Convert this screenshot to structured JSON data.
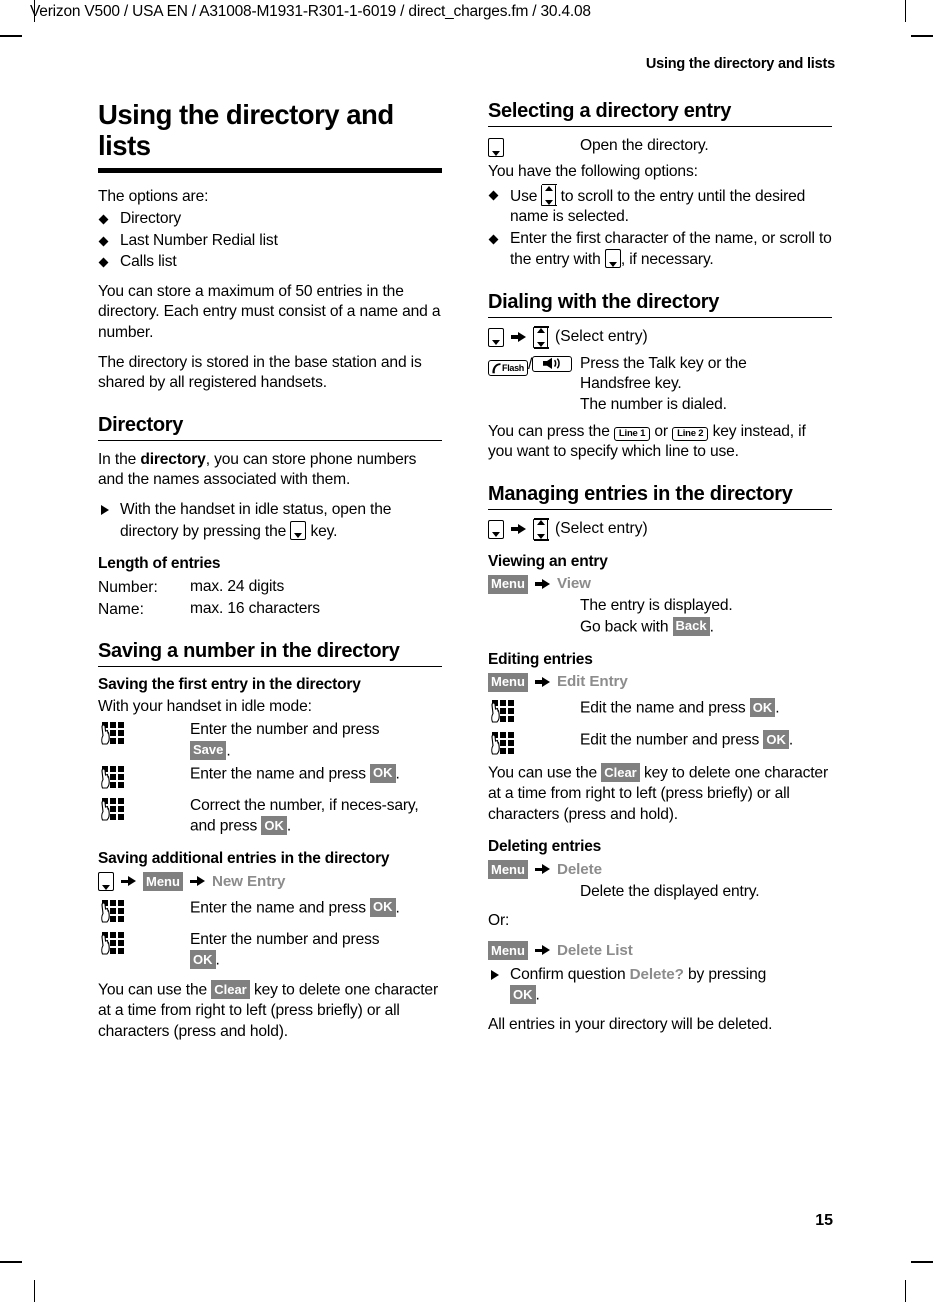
{
  "page": {
    "filemark": "Verizon V500 / USA EN / A31008-M1931-R301-1-6019 / direct_charges.fm / 30.4.08",
    "running_head": "Using the directory and lists",
    "page_number": "15"
  },
  "icons": {
    "directory_key": "directory-down-key-icon",
    "scroll_key": "up-down-scroll-key-icon",
    "keypad": "keypad-entry-icon",
    "talk_key": "talk-flash-key-icon",
    "handsfree_key": "handsfree-speaker-key-icon",
    "arrow": "right-arrow-icon"
  },
  "colors": {
    "softkey_bg": "#808080",
    "softkey_fg": "#ffffff",
    "menu_item_fg": "#8c8c8c",
    "rule": "#000000"
  },
  "left_column": {
    "chapter_title": "Using the directory and lists",
    "intro_lead": "The options are:",
    "options": [
      "Directory",
      "Last Number Redial list",
      "Calls list"
    ],
    "para_capacity": "You can store a maximum of 50 entries in the directory. Each entry must consist of a name and a number.",
    "para_shared": "The directory is stored in the base station and is shared by all registered handsets.",
    "directory": {
      "heading": "Directory",
      "intro_a": "In the ",
      "intro_bold": "directory",
      "intro_b": ", you can store phone numbers and the names associated with them.",
      "bullet_a": "With the handset in idle status, open the directory by pressing the",
      "bullet_b": "key.",
      "length_heading": "Length of entries",
      "length_rows": [
        {
          "label": "Number:",
          "value": "max. 24 digits"
        },
        {
          "label": "Name:",
          "value": "max. 16 characters"
        }
      ]
    },
    "saving": {
      "heading": "Saving a number in the directory",
      "first_entry": {
        "heading": "Saving the first entry in the directory",
        "lead": "With your handset in idle mode:",
        "step1_a": "Enter the number and press",
        "step1_key": "Save",
        "step1_b": ".",
        "step2_a": "Enter the name and press",
        "step2_key": "OK",
        "step2_b": ".",
        "step3_a": "Correct the number, if neces-sary, and press",
        "step3_key": "OK",
        "step3_b": "."
      },
      "additional": {
        "heading": "Saving additional entries in the directory",
        "path_menu": "Menu",
        "path_item": "New Entry",
        "step1_a": "Enter the name and press",
        "step1_key": "OK",
        "step1_b": ".",
        "step2_a": "Enter the number and press",
        "step2_key": "OK",
        "step2_b": "."
      },
      "clear_note_a": "You can use the",
      "clear_note_key": "Clear",
      "clear_note_b": "key to delete one character at a time from right to left (press briefly) or all characters (press and hold)."
    }
  },
  "right_column": {
    "selecting": {
      "heading": "Selecting a directory entry",
      "open_text": "Open the directory.",
      "options_lead": "You have the following options:",
      "option1_a": "Use",
      "option1_b": "to scroll to the entry until the desired name is selected.",
      "option2_a": "Enter the first character of the name, or scroll to the entry with",
      "option2_b": ", if necessary."
    },
    "dialing": {
      "heading": "Dialing with the directory",
      "path_select": "(Select entry)",
      "talk_label": "Flash",
      "step_text_l1": "Press the Talk key or the",
      "step_text_l2": "Handsfree key.",
      "step_text_l3": "The number is dialed.",
      "line_note_a": "You can press the",
      "line1_key": "Line 1",
      "line_note_or": "or",
      "line2_key": "Line 2",
      "line_note_b": "key instead, if you want to specify which line to use."
    },
    "managing": {
      "heading": "Managing entries in the directory",
      "path_select": "(Select entry)",
      "viewing": {
        "heading": "Viewing an entry",
        "path_menu": "Menu",
        "path_item": "View",
        "line1": "The entry is displayed.",
        "line2_a": "Go back with",
        "line2_key": "Back",
        "line2_b": "."
      },
      "editing": {
        "heading": "Editing entries",
        "path_menu": "Menu",
        "path_item": "Edit Entry",
        "step1_a": "Edit the name and press",
        "step1_key": "OK",
        "step1_b": ".",
        "step2_a": "Edit the number and press",
        "step2_key": "OK",
        "step2_b": ".",
        "clear_note_a": "You can use the",
        "clear_note_key": "Clear",
        "clear_note_b": "key to delete one character at a time from right to left (press briefly) or all characters (press and hold)."
      },
      "deleting": {
        "heading": "Deleting entries",
        "path_menu": "Menu",
        "path_item": "Delete",
        "delete_text": "Delete the displayed entry.",
        "or": "Or:",
        "path_menu2": "Menu",
        "path_item2": "Delete List",
        "confirm_a": "Confirm question",
        "confirm_item": "Delete?",
        "confirm_b": "by pressing",
        "confirm_key": "OK",
        "confirm_c": ".",
        "all_deleted": "All entries in your directory will be deleted."
      }
    }
  }
}
